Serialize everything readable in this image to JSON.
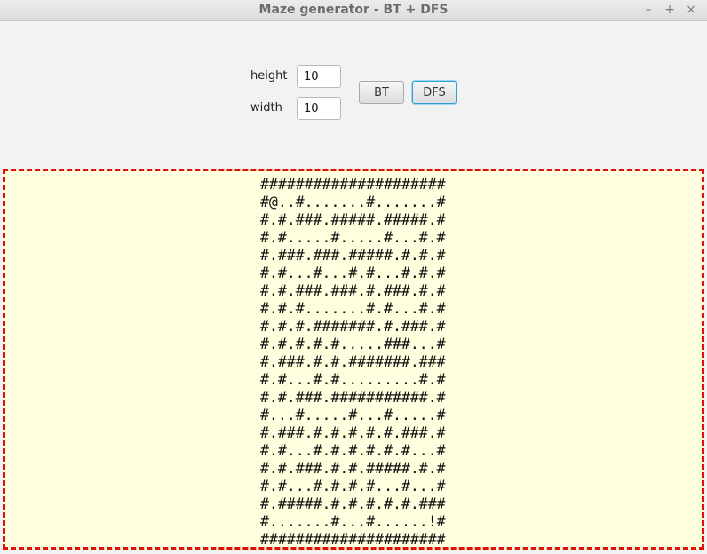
{
  "window": {
    "title": "Maze generator - BT + DFS",
    "buttons": {
      "minimize": "–",
      "maximize": "+",
      "close": "×"
    }
  },
  "controls": {
    "height_label": "height",
    "height_value": "10",
    "width_label": "width",
    "width_value": "10",
    "bt_button": "BT",
    "dfs_button": "DFS"
  },
  "maze": {
    "rows": [
      "#####################",
      "#@..#.......#.......#",
      "#.#.###.#####.#####.#",
      "#.#.....#.....#...#.#",
      "#.###.###.#####.#.#.#",
      "#.#...#...#.#...#.#.#",
      "#.#.###.###.#.###.#.#",
      "#.#.#.......#.#...#.#",
      "#.#.#.#######.#.###.#",
      "#.#.#.#.#.....###...#",
      "#.###.#.#.#######.###",
      "#.#...#.#.........#.#",
      "#.#.###.###########.#",
      "#...#.....#...#.....#",
      "#.###.#.#.#.#.#.###.#",
      "#.#...#.#.#.#.#.#...#",
      "#.#.###.#.#.#####.#.#",
      "#.#...#.#.#.#...#...#",
      "#.#####.#.#.#.#.#.###",
      "#.......#...#......!#",
      "#####################"
    ]
  },
  "colors": {
    "maze_background": "#ffffdf",
    "maze_border": "#e0100a",
    "focus_accent": "#2d9fd9"
  }
}
